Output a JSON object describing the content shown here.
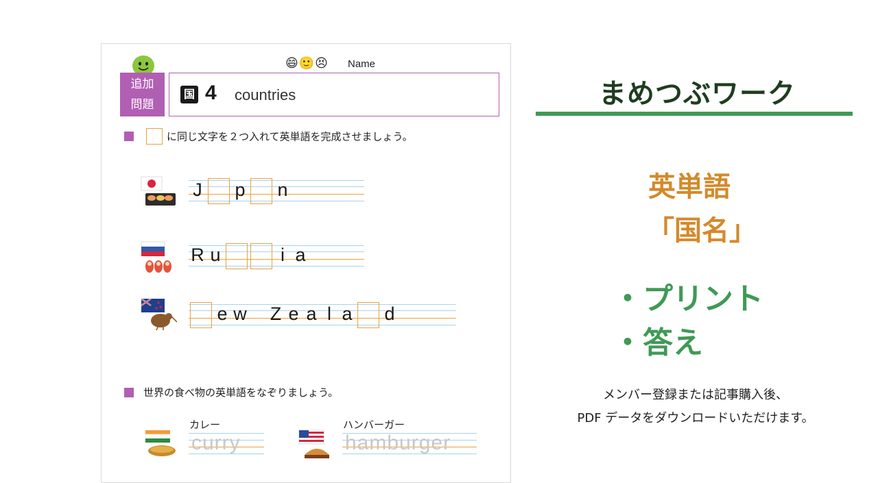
{
  "worksheet": {
    "faces": "😄🙂😣",
    "name_label": "Name",
    "tag_line1": "追加",
    "tag_line2": "問題",
    "subject_icon": "国",
    "lesson_number": "4",
    "topic": "countries",
    "instruction1": "に同じ文字を２つ入れて英単語を完成させましょう。",
    "instruction2": "世界の食べ物の英単語をなぞりましょう。",
    "words": [
      {
        "letters": [
          "J",
          "_",
          "p",
          "_",
          "n"
        ],
        "icon": "japan-flag-sushi-icon"
      },
      {
        "letters": [
          "R",
          "u",
          "_",
          "_",
          "i",
          "a"
        ],
        "icon": "russia-flag-matryoshka-icon"
      },
      {
        "letters": [
          "_",
          "e",
          "w",
          " ",
          "Z",
          "e",
          "a",
          "l",
          "a",
          "_",
          "d"
        ],
        "icon": "new-zealand-flag-kiwi-icon"
      }
    ],
    "foods": [
      {
        "label": "カレー",
        "trace": "curry",
        "icon": "india-flag-curry-icon"
      },
      {
        "label": "ハンバーガー",
        "trace": "hamburger",
        "icon": "usa-flag-hamburger-icon"
      }
    ],
    "colors": {
      "accent_purple": "#b15fb3",
      "blank_orange": "#e8a23b",
      "guide_blue": "#a9d2ea"
    }
  },
  "panel": {
    "brand": "まめつぶワーク",
    "heading1": "英単語",
    "heading2": "「国名」",
    "bullet1": "・プリント",
    "bullet2": "・答え",
    "note1": "メンバー登録または記事購入後、",
    "note2": "PDF データをダウンロードいただけます。",
    "colors": {
      "brand_green": "#3f9a55",
      "heading_orange": "#d48a2b"
    }
  }
}
